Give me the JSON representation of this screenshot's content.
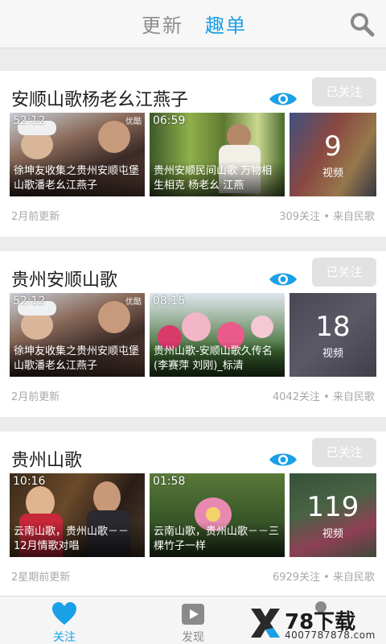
{
  "header": {
    "tab_update": "更新",
    "tab_qudan": "趣单",
    "active_tab": "趣单",
    "accent": "#1aa0e6"
  },
  "cards": [
    {
      "title": "安顺山歌杨老幺江燕子",
      "follow_label": "已关注",
      "videos": [
        {
          "duration": "52:12",
          "caption": "徐坤友收集之贵州安顺屯堡山歌潘老幺江燕子",
          "watermark": "优酷"
        },
        {
          "duration": "06:59",
          "caption": "贵州安顺民间山歌 万物相生相克 杨老幺 江燕"
        }
      ],
      "count": "9",
      "count_label": "视频",
      "updated": "2月前更新",
      "stats": "309关注 • 来自民歌"
    },
    {
      "title": "贵州安顺山歌",
      "follow_label": "已关注",
      "videos": [
        {
          "duration": "52:12",
          "caption": "徐坤友收集之贵州安顺屯堡山歌潘老幺江燕子",
          "watermark": "优酷"
        },
        {
          "duration": "08:15",
          "caption": "贵州山歌-安顺山歌久传名(李赛萍 刘刚)_标清"
        }
      ],
      "count": "18",
      "count_label": "视频",
      "updated": "2月前更新",
      "stats": "4042关注 • 来自民歌"
    },
    {
      "title": "贵州山歌",
      "follow_label": "已关注",
      "videos": [
        {
          "duration": "10:16",
          "caption": "云南山歌，贵州山歌－－12月情歌对唱"
        },
        {
          "duration": "01:58",
          "caption": "云南山歌，贵州山歌－－三棵竹子一样"
        }
      ],
      "count": "119",
      "count_label": "视频",
      "updated": "2星期前更新",
      "stats": "6929关注 • 来自民歌"
    }
  ],
  "bottom_nav": {
    "follow_label": "关注",
    "discover_label": "发现"
  },
  "watermark_logo": {
    "text": "78下载",
    "sub": "4007787878.com"
  }
}
